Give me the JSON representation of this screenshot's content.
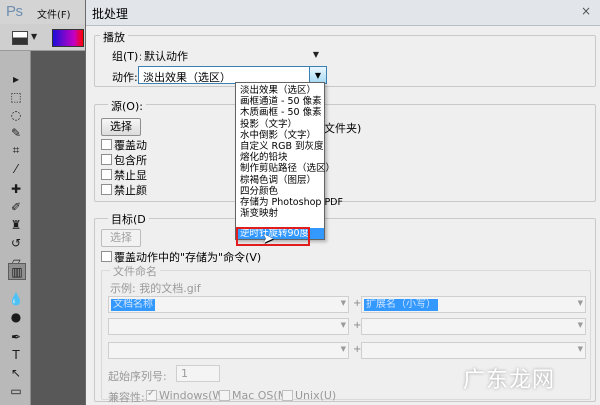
{
  "photoshop": {
    "logo": "Ps",
    "menu_file": "文件(F)"
  },
  "dialog": {
    "title": "批处理",
    "close": "×",
    "play": {
      "section_label": "播放",
      "set_label": "组(T):",
      "set_value": "默认动作",
      "action_label": "动作:",
      "action_value": "淡出效果（选区）"
    },
    "source": {
      "label": "源(O):",
      "choose_button": "选择",
      "folder_suffix": "文件夹)",
      "checkboxes": [
        "覆盖动",
        "包含所",
        "禁止显",
        "禁止颜"
      ]
    },
    "destination": {
      "label": "目标(D",
      "choose_button": "选择",
      "override_save": "覆盖动作中的\"存储为\"命令(V)",
      "file_naming": {
        "label": "文件命名",
        "example": "示例: 我的文档.gif",
        "row1_left": "文档名称",
        "row1_right": "扩展名（小写）",
        "serial_label": "起始序列号:",
        "serial_value": "1",
        "compat_label": "兼容性:",
        "compat_windows": "Windows(W)",
        "compat_mac": "Mac OS(M)",
        "compat_unix": "Unix(U)"
      }
    },
    "action_list": [
      "淡出效果（选区）",
      "画框通道 - 50 像素",
      "木质画框 - 50 像素",
      "投影（文字）",
      "水中倒影（文字）",
      "自定义 RGB 到灰度",
      "熔化的铅块",
      "制作剪贴路径（选区）",
      "棕褐色调（图层）",
      "四分颜色",
      "存储为 Photoshop PDF",
      "渐变映射",
      "逆时针旋转90度"
    ],
    "highlighted_index": 12
  },
  "watermark": "广东龙网",
  "colors": {
    "highlight": "#3399ff",
    "red_annotation": "#e01c1c",
    "combo_focus": "#3c7fb1"
  }
}
